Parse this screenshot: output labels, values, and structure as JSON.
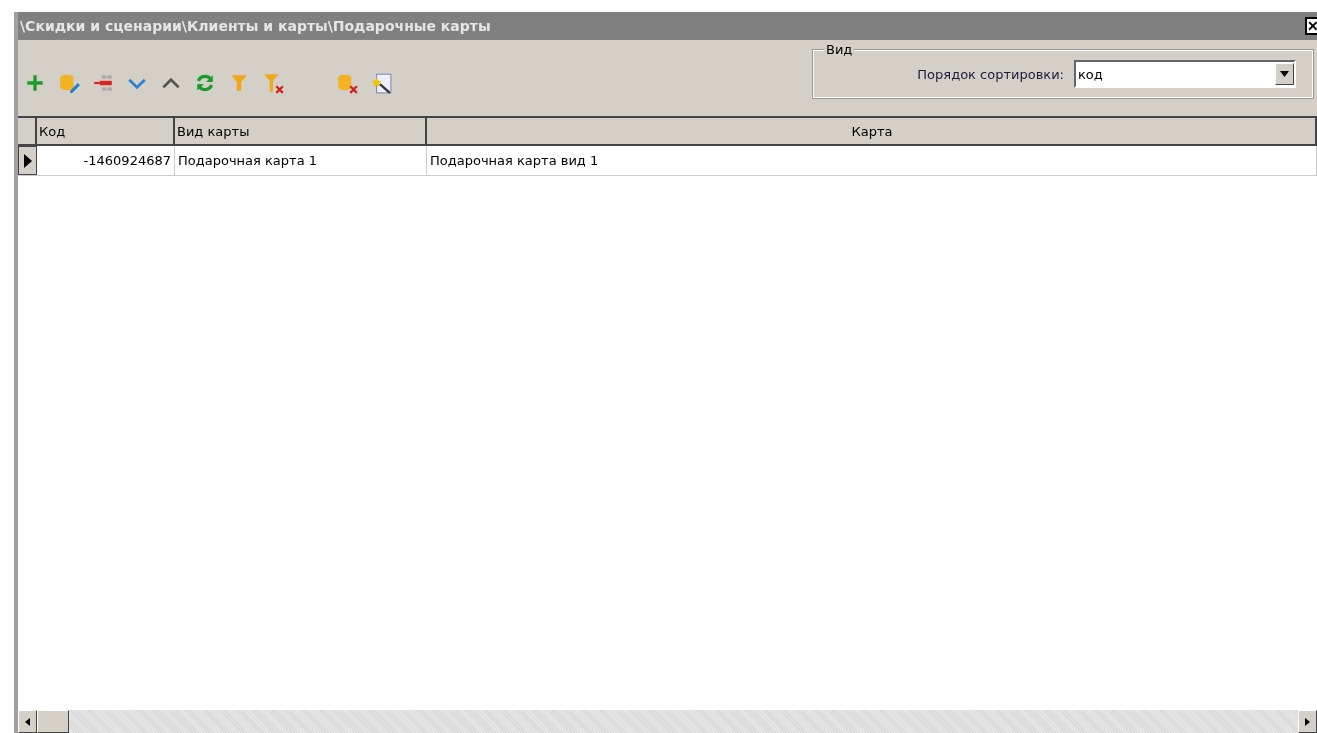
{
  "window": {
    "title": "\\Скидки и сценарии\\Клиенты и карты\\Подарочные карты",
    "close": "✕"
  },
  "toolbar": [
    {
      "kind": "add"
    },
    {
      "kind": "edit"
    },
    {
      "kind": "delete"
    },
    {
      "kind": "down"
    },
    {
      "kind": "up"
    },
    {
      "kind": "refresh"
    },
    {
      "kind": "filter"
    },
    {
      "kind": "clear-filter"
    },
    {
      "kind": "gap"
    },
    {
      "kind": "db-delete"
    },
    {
      "kind": "wizard"
    }
  ],
  "view_group": {
    "legend": "Вид",
    "sort_label": "Порядок сортировки:",
    "sort_value": "код"
  },
  "table": {
    "columns": [
      "Код",
      "Вид карты",
      "Карта"
    ],
    "rows": [
      {
        "selected": true,
        "cells": [
          "-1460924687",
          "Подарочная карта 1",
          "Подарочная карта вид 1"
        ]
      }
    ]
  }
}
